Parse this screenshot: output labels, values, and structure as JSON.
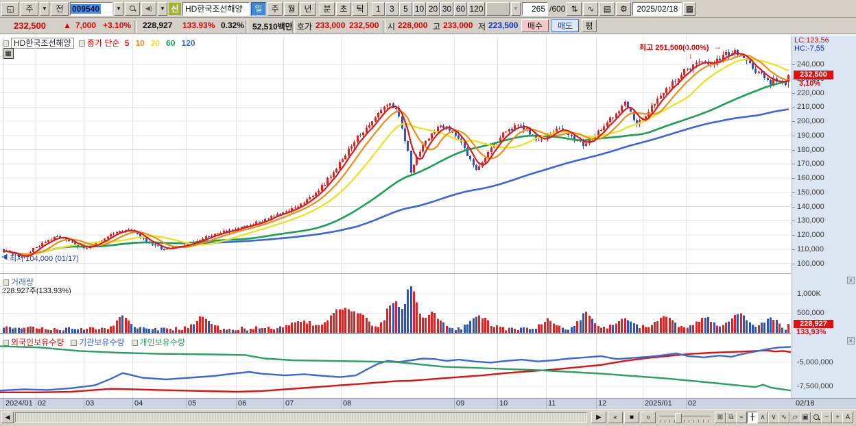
{
  "toolbar": {
    "window_icon": "chart-window",
    "combo_week": "주",
    "btn_prev": "전",
    "code_input": "009540",
    "new_badge": "신",
    "stock_name": "HD한국조선해양",
    "period_tabs": [
      "일",
      "주",
      "월",
      "년"
    ],
    "tick_tabs": [
      "분",
      "초",
      "틱"
    ],
    "minute_buttons": [
      "1",
      "3",
      "5",
      "10",
      "20",
      "30",
      "60",
      "120"
    ],
    "candle_count": "265",
    "candle_total": "/600",
    "date": "2025/02/18",
    "icon_glyphs": {
      "compare": "⇅",
      "chart_plus": "∿",
      "save": "▤",
      "gear": "⚙",
      "calendar": "▦",
      "speaker": "◀)",
      "window": "◱",
      "dropdown": "▼"
    }
  },
  "quote": {
    "price": "232,500",
    "arrow": "▲",
    "change": "7,000",
    "pct": "+3.10%",
    "volume": "228,927",
    "vol_pct": "133.93%",
    "turn_pct": "0.32%",
    "amount": "52,510백만",
    "hoga_label": "호가",
    "ask": "233,000",
    "bid": "232,500",
    "open_label": "시",
    "open": "228,000",
    "high_label": "고",
    "high": "233,000",
    "low_label": "저",
    "low": "223,500",
    "buy_btn": "매수",
    "sell_btn": "매도",
    "avg_btn": "평"
  },
  "price_pane": {
    "name_box": "HD한국조선해양",
    "legend_prefix": "종가 단순",
    "high_annotation": "최고 251,500(0.00%)",
    "high_arrow_right": "→",
    "high_arrow_down": "↓",
    "low_arrow": "◀",
    "low_annotation": "최저 104,000 (01/17)",
    "lc": "LC:123,56",
    "hc": "HC:-7,55",
    "badge_price": "232,500",
    "badge_pct": "3,10%"
  },
  "volume_pane": {
    "title": "거래량",
    "subtitle": "228,927주(133,93%)",
    "tick_1000k": "1,000K",
    "tick_500k": "500,000",
    "badge": "228,927",
    "badge_pct": "133,93%",
    "close_glyph": "×"
  },
  "holdings_pane": {
    "tick_a": "-5,000,000",
    "tick_b": "-7,500,000",
    "close_glyph": "×"
  },
  "xaxis_right_label": "02/18",
  "bottombar": {
    "pan_left": "◀",
    "transport": [
      {
        "name": "play-button",
        "glyph": "▶"
      },
      {
        "name": "rewind-button",
        "glyph": "«"
      },
      {
        "name": "stop-button",
        "glyph": "■"
      },
      {
        "name": "forward-button",
        "glyph": "»"
      }
    ],
    "icons": [
      {
        "name": "add-grid-icon",
        "glyph": "⊞",
        "pressed": false
      },
      {
        "name": "duplicate-chart-icon",
        "glyph": "⧉",
        "pressed": false
      },
      {
        "name": "dotted-line-icon",
        "glyph": "⌁",
        "pressed": false
      },
      {
        "name": "trendline-tool-icon",
        "glyph": "╂",
        "pressed": true
      },
      {
        "name": "peak-tool-icon",
        "glyph": "∧",
        "pressed": false
      },
      {
        "name": "trough-tool-icon",
        "glyph": "∨",
        "pressed": false
      },
      {
        "name": "wave-tool-icon",
        "glyph": "∿",
        "pressed": false
      },
      {
        "name": "shape-tool-icon",
        "glyph": "▱",
        "pressed": false
      },
      {
        "name": "export-image-icon",
        "glyph": "▣",
        "pressed": false
      },
      {
        "name": "zoom-chart-icon",
        "glyph": "",
        "pressed": false
      },
      {
        "name": "smaller-button",
        "glyph": "−",
        "pressed": false
      },
      {
        "name": "larger-button",
        "glyph": "+",
        "pressed": false
      },
      {
        "name": "font-button",
        "glyph": "A",
        "pressed": false
      }
    ]
  },
  "chart_data": {
    "type": "candlestick",
    "symbol": "HD한국조선해양",
    "code": "009540",
    "bars_visible": 265,
    "bars_total": 600,
    "ohlc_today": {
      "open": 228000,
      "high": 233000,
      "low": 223500,
      "close": 232500,
      "change": 7000,
      "change_pct": 3.1,
      "volume_shares": 228927,
      "volume_pct_prev": 133.93,
      "amount": "52,510백만"
    },
    "period_high": {
      "value": 251500
    },
    "period_low": {
      "value": 104000,
      "date": "01/17"
    },
    "ylim": [
      92500,
      260300
    ],
    "y_ticks": [
      240000,
      230000,
      220000,
      210000,
      200000,
      190000,
      180000,
      170000,
      160000,
      150000,
      140000,
      130000,
      120000,
      110000,
      100000
    ],
    "ma_lines": [
      {
        "period": 5,
        "color": "#e01818",
        "width": 2.2
      },
      {
        "period": 10,
        "color": "#f08c14",
        "width": 2.2
      },
      {
        "period": 20,
        "color": "#e8e426",
        "width": 2.4
      },
      {
        "period": 60,
        "color": "#1a9e54",
        "width": 2.6
      },
      {
        "period": 120,
        "color": "#3c64dc",
        "width": 2.6
      }
    ],
    "up_color": "#e02222",
    "down_color": "#2e52c0",
    "price_anchors": [
      [
        0,
        109000
      ],
      [
        3,
        106500
      ],
      [
        6,
        104000
      ],
      [
        9,
        108000
      ],
      [
        11,
        112000
      ],
      [
        15,
        116000
      ],
      [
        18,
        119500
      ],
      [
        22,
        115000
      ],
      [
        25,
        112000
      ],
      [
        28,
        111000
      ],
      [
        32,
        114500
      ],
      [
        36,
        120000
      ],
      [
        39,
        123500
      ],
      [
        43,
        122500
      ],
      [
        47,
        117000
      ],
      [
        51,
        112000
      ],
      [
        54,
        110000
      ],
      [
        58,
        111500
      ],
      [
        61,
        112500
      ],
      [
        65,
        116000
      ],
      [
        70,
        120000
      ],
      [
        74,
        122500
      ],
      [
        78,
        124000
      ],
      [
        83,
        127000
      ],
      [
        88,
        131000
      ],
      [
        92,
        134000
      ],
      [
        96,
        137500
      ],
      [
        100,
        142000
      ],
      [
        104,
        148000
      ],
      [
        108,
        156000
      ],
      [
        111,
        165000
      ],
      [
        114,
        173000
      ],
      [
        118,
        186000
      ],
      [
        122,
        196000
      ],
      [
        126,
        205000
      ],
      [
        130,
        213500
      ],
      [
        132,
        208000
      ],
      [
        134,
        196000
      ],
      [
        136,
        178000
      ],
      [
        137,
        165000
      ],
      [
        139,
        176000
      ],
      [
        141,
        184000
      ],
      [
        144,
        191000
      ],
      [
        147,
        197000
      ],
      [
        150,
        195000
      ],
      [
        153,
        188000
      ],
      [
        156,
        176000
      ],
      [
        159,
        166000
      ],
      [
        161,
        172000
      ],
      [
        164,
        181000
      ],
      [
        167,
        189000
      ],
      [
        170,
        194000
      ],
      [
        173,
        196500
      ],
      [
        176,
        194000
      ],
      [
        179,
        188000
      ],
      [
        181,
        186000
      ],
      [
        184,
        191000
      ],
      [
        187,
        195500
      ],
      [
        190,
        191000
      ],
      [
        193,
        186000
      ],
      [
        195,
        183000
      ],
      [
        198,
        188000
      ],
      [
        200,
        193000
      ],
      [
        203,
        199000
      ],
      [
        206,
        206000
      ],
      [
        209,
        213000
      ],
      [
        211,
        206000
      ],
      [
        213,
        198000
      ],
      [
        215,
        201000
      ],
      [
        217,
        207000
      ],
      [
        220,
        215000
      ],
      [
        223,
        222000
      ],
      [
        226,
        229000
      ],
      [
        229,
        235000
      ],
      [
        232,
        239500
      ],
      [
        235,
        243000
      ],
      [
        237,
        240000
      ],
      [
        240,
        242500
      ],
      [
        243,
        247000
      ],
      [
        246,
        250500
      ],
      [
        248,
        246000
      ],
      [
        250,
        241000
      ],
      [
        252,
        237000
      ],
      [
        255,
        232500
      ],
      [
        258,
        227500
      ],
      [
        260,
        229500
      ],
      [
        262,
        226500
      ],
      [
        263,
        225500
      ],
      [
        264,
        232500
      ]
    ],
    "volume": {
      "unit": "K",
      "ylim_k": [
        0,
        1475
      ],
      "ticks_k": [
        1000,
        500
      ],
      "base_min": 60,
      "base_range": 110,
      "bumps": [
        [
          40,
          3,
          320
        ],
        [
          67,
          3,
          300
        ],
        [
          100,
          5,
          200
        ],
        [
          112,
          4,
          350
        ],
        [
          118,
          5,
          420
        ],
        [
          131,
          3,
          700
        ],
        [
          137,
          2.5,
          1050
        ],
        [
          144,
          4,
          380
        ],
        [
          160,
          4,
          280
        ],
        [
          183,
          3,
          220
        ],
        [
          196,
          3,
          380
        ],
        [
          209,
          4,
          260
        ],
        [
          222,
          4,
          300
        ],
        [
          236,
          4,
          260
        ],
        [
          247,
          4,
          380
        ],
        [
          258,
          3,
          260
        ]
      ],
      "last_k": 228.927
    },
    "holdings": {
      "series": [
        {
          "name": "외국인보유수량",
          "color": "#dd1111",
          "path": [
            [
              0,
              0.95
            ],
            [
              0.05,
              0.95
            ],
            [
              0.09,
              0.94
            ],
            [
              0.12,
              0.91
            ],
            [
              0.14,
              0.89
            ],
            [
              0.17,
              0.9
            ],
            [
              0.2,
              0.91
            ],
            [
              0.23,
              0.92
            ],
            [
              0.26,
              0.93
            ],
            [
              0.3,
              0.94
            ],
            [
              0.33,
              0.93
            ],
            [
              0.36,
              0.9
            ],
            [
              0.39,
              0.87
            ],
            [
              0.42,
              0.84
            ],
            [
              0.45,
              0.81
            ],
            [
              0.47,
              0.79
            ],
            [
              0.5,
              0.76
            ],
            [
              0.52,
              0.75
            ],
            [
              0.55,
              0.72
            ],
            [
              0.58,
              0.69
            ],
            [
              0.61,
              0.66
            ],
            [
              0.64,
              0.62
            ],
            [
              0.67,
              0.59
            ],
            [
              0.7,
              0.56
            ],
            [
              0.73,
              0.52
            ],
            [
              0.76,
              0.48
            ],
            [
              0.79,
              0.41
            ],
            [
              0.82,
              0.36
            ],
            [
              0.85,
              0.32
            ],
            [
              0.875,
              0.29
            ],
            [
              0.9,
              0.27
            ],
            [
              0.92,
              0.26
            ],
            [
              0.94,
              0.25
            ],
            [
              0.955,
              0.24
            ],
            [
              0.97,
              0.23
            ],
            [
              0.98,
              0.25
            ],
            [
              0.99,
              0.24
            ],
            [
              1,
              0.26
            ]
          ]
        },
        {
          "name": "기관보유수량",
          "color": "#3a68d8",
          "path": [
            [
              0,
              0.92
            ],
            [
              0.03,
              0.9
            ],
            [
              0.06,
              0.91
            ],
            [
              0.09,
              0.88
            ],
            [
              0.12,
              0.83
            ],
            [
              0.14,
              0.72
            ],
            [
              0.155,
              0.62
            ],
            [
              0.165,
              0.65
            ],
            [
              0.18,
              0.7
            ],
            [
              0.21,
              0.73
            ],
            [
              0.24,
              0.7
            ],
            [
              0.27,
              0.67
            ],
            [
              0.295,
              0.63
            ],
            [
              0.315,
              0.6
            ],
            [
              0.33,
              0.63
            ],
            [
              0.36,
              0.66
            ],
            [
              0.385,
              0.64
            ],
            [
              0.41,
              0.67
            ],
            [
              0.43,
              0.69
            ],
            [
              0.45,
              0.66
            ],
            [
              0.465,
              0.55
            ],
            [
              0.478,
              0.46
            ],
            [
              0.49,
              0.41
            ],
            [
              0.505,
              0.43
            ],
            [
              0.52,
              0.4
            ],
            [
              0.535,
              0.37
            ],
            [
              0.55,
              0.38
            ],
            [
              0.565,
              0.41
            ],
            [
              0.58,
              0.39
            ],
            [
              0.6,
              0.42
            ],
            [
              0.62,
              0.44
            ],
            [
              0.64,
              0.41
            ],
            [
              0.66,
              0.39
            ],
            [
              0.68,
              0.42
            ],
            [
              0.7,
              0.4
            ],
            [
              0.72,
              0.37
            ],
            [
              0.74,
              0.35
            ],
            [
              0.76,
              0.33
            ],
            [
              0.78,
              0.38
            ],
            [
              0.8,
              0.36
            ],
            [
              0.82,
              0.34
            ],
            [
              0.84,
              0.31
            ],
            [
              0.855,
              0.28
            ],
            [
              0.87,
              0.33
            ],
            [
              0.89,
              0.35
            ],
            [
              0.91,
              0.32
            ],
            [
              0.925,
              0.34
            ],
            [
              0.94,
              0.29
            ],
            [
              0.955,
              0.25
            ],
            [
              0.97,
              0.21
            ],
            [
              0.985,
              0.18
            ],
            [
              1,
              0.17
            ]
          ]
        },
        {
          "name": "개인보유수량",
          "color": "#2b9e62",
          "path": [
            [
              0,
              0.16
            ],
            [
              0.05,
              0.18
            ],
            [
              0.1,
              0.24
            ],
            [
              0.15,
              0.27
            ],
            [
              0.2,
              0.29
            ],
            [
              0.27,
              0.3
            ],
            [
              0.31,
              0.31
            ],
            [
              0.335,
              0.37
            ],
            [
              0.37,
              0.4
            ],
            [
              0.42,
              0.41
            ],
            [
              0.46,
              0.42
            ],
            [
              0.5,
              0.43
            ],
            [
              0.53,
              0.47
            ],
            [
              0.56,
              0.51
            ],
            [
              0.6,
              0.53
            ],
            [
              0.64,
              0.55
            ],
            [
              0.68,
              0.57
            ],
            [
              0.72,
              0.6
            ],
            [
              0.76,
              0.63
            ],
            [
              0.8,
              0.67
            ],
            [
              0.84,
              0.71
            ],
            [
              0.88,
              0.76
            ],
            [
              0.91,
              0.8
            ],
            [
              0.94,
              0.84
            ],
            [
              0.955,
              0.86
            ],
            [
              0.965,
              0.82
            ],
            [
              0.975,
              0.87
            ],
            [
              0.99,
              0.9
            ],
            [
              1,
              0.92
            ]
          ]
        }
      ],
      "ticks": [
        -5000000,
        -7500000
      ]
    },
    "xaxis_months": [
      {
        "label": "2024/01",
        "x": 0.004
      },
      {
        "label": "02",
        "x": 0.045
      },
      {
        "label": "03",
        "x": 0.106
      },
      {
        "label": "04",
        "x": 0.167
      },
      {
        "label": "05",
        "x": 0.235
      },
      {
        "label": "06",
        "x": 0.298
      },
      {
        "label": "07",
        "x": 0.358
      },
      {
        "label": "08",
        "x": 0.431
      },
      {
        "label": "09",
        "x": 0.574
      },
      {
        "label": "10",
        "x": 0.629
      },
      {
        "label": "11",
        "x": 0.69
      },
      {
        "label": "12",
        "x": 0.754
      },
      {
        "label": "2025/01",
        "x": 0.813
      },
      {
        "label": "02",
        "x": 0.867
      }
    ],
    "xaxis_right_label": "02/18"
  }
}
